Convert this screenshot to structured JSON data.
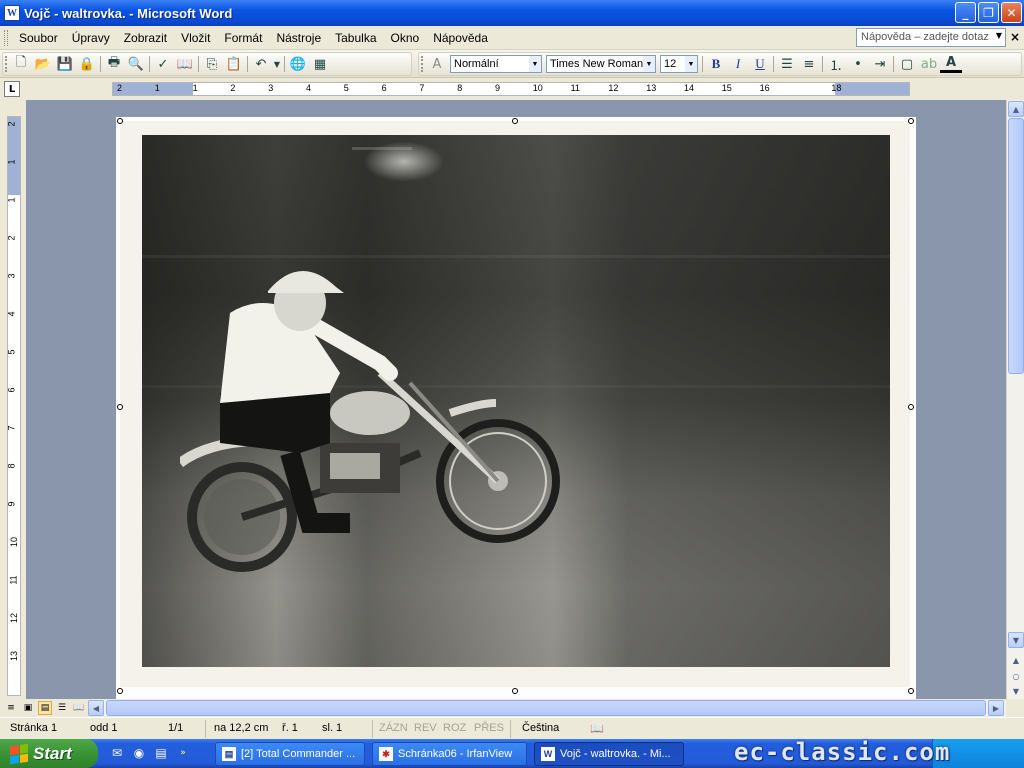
{
  "window": {
    "title": "Vojč - waltrovka. - Microsoft Word",
    "app_icon": "W",
    "buttons": [
      "minimize-icon",
      "restore-icon",
      "close-icon"
    ]
  },
  "menu": {
    "items": [
      "Soubor",
      "Úpravy",
      "Zobrazit",
      "Vložit",
      "Formát",
      "Nástroje",
      "Tabulka",
      "Okno",
      "Nápověda"
    ],
    "help_placeholder": "Nápověda – zadejte dotaz"
  },
  "toolbar": {
    "style": "Normální",
    "font": "Times New Roman",
    "size": "12",
    "bold": "B",
    "italic": "I",
    "underline": "U"
  },
  "ruler": {
    "h_labels": [
      "2",
      "1",
      "1",
      "2",
      "3",
      "4",
      "5",
      "6",
      "7",
      "8",
      "9",
      "10",
      "11",
      "12",
      "13",
      "14",
      "15",
      "16",
      "18"
    ],
    "v_labels": [
      "2",
      "1",
      "1",
      "2",
      "3",
      "4",
      "5",
      "6",
      "7",
      "8",
      "9",
      "10",
      "11",
      "12",
      "13"
    ],
    "tab_selector": "L"
  },
  "status": {
    "page": "Stránka  1",
    "section": "odd  1",
    "pages": "1/1",
    "position": "na  12,2 cm",
    "line": "ř.  1",
    "column": "sl.  1",
    "rec": "ZÁZN",
    "trk": "REV",
    "ext": "ROZ",
    "ovr": "PŘES",
    "language": "Čeština"
  },
  "taskbar": {
    "start": "Start",
    "tasks": [
      "[2] Total Commander ...",
      "Schránka06 - IrfanView",
      "Vojč - waltrovka. - Mi..."
    ],
    "watermark": "ec-classic.com"
  },
  "colors": {
    "titlebar": "#0a54e3",
    "start": "#3a9435",
    "workspace": "#8a96ac"
  }
}
